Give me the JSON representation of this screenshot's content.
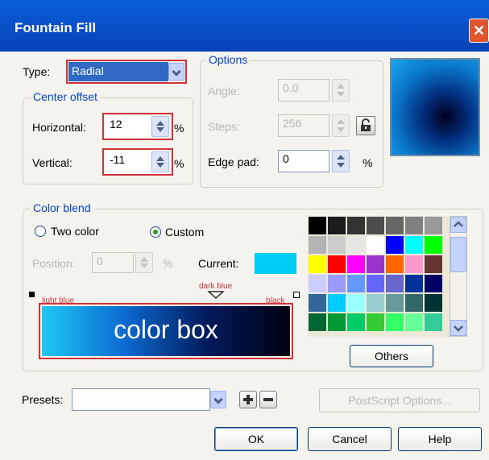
{
  "window": {
    "title": "Fountain Fill",
    "close_glyph": "✕"
  },
  "type": {
    "label": "Type:",
    "value": "Radial"
  },
  "center_offset": {
    "title": "Center offset",
    "horizontal": {
      "label": "Horizontal:",
      "value": "12",
      "unit": "%"
    },
    "vertical": {
      "label": "Vertical:",
      "value": "-11",
      "unit": "%"
    }
  },
  "options": {
    "title": "Options",
    "angle": {
      "label": "Angle:",
      "value": "0.0"
    },
    "steps": {
      "label": "Steps:",
      "value": "256"
    },
    "edge_pad": {
      "label": "Edge pad:",
      "value": "0",
      "unit": "%"
    }
  },
  "color_blend": {
    "title": "Color blend",
    "two_color_label": "Two color",
    "custom_label": "Custom",
    "selected_mode": "Custom",
    "position": {
      "label": "Position:",
      "value": "0",
      "unit": "%"
    },
    "current_label": "Current:",
    "current_color": "#00ccf4",
    "gradient": {
      "start_label": "light blue",
      "mid_label": "dark blue",
      "end_label": "black",
      "box_text": "color box",
      "colors": [
        "#1ec8f5",
        "#0b6ad0",
        "#021a5c",
        "#000010"
      ]
    },
    "palette": [
      "#000000",
      "#1c1c1c",
      "#333333",
      "#4d4d4d",
      "#666666",
      "#808080",
      "#999999",
      "#b3b3b3",
      "#cccccc",
      "#e6e6e6",
      "#ffffff",
      "#0000ff",
      "#00ffff",
      "#00ff00",
      "#ffff00",
      "#ff0000",
      "#ff00ff",
      "#9933cc",
      "#ff6600",
      "#ff99cc",
      "#663333",
      "#ccccff",
      "#9999ff",
      "#6699ff",
      "#6666ff",
      "#6666cc",
      "#003399",
      "#000066",
      "#336699",
      "#00ccff",
      "#99ffff",
      "#99cccc",
      "#669999",
      "#336666",
      "#003333",
      "#006633",
      "#009933",
      "#00cc66",
      "#33cc33",
      "#33ff66",
      "#66ff99",
      "#33cc99"
    ],
    "others_label": "Others"
  },
  "presets": {
    "label": "Presets:",
    "value": "",
    "postscript_label": "PostScript Options..."
  },
  "buttons": {
    "ok": "OK",
    "cancel": "Cancel",
    "help": "Help"
  },
  "preview": {
    "colors": [
      "#000020",
      "#032e7e",
      "#0a78cc",
      "#1aa6ea"
    ]
  }
}
